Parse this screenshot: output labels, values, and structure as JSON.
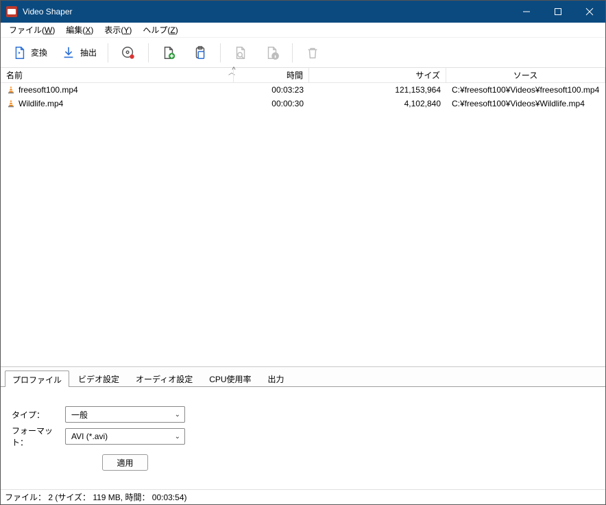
{
  "title": "Video Shaper",
  "menu": {
    "file": "ファイル(W)",
    "edit": "編集(X)",
    "view": "表示(Y)",
    "help": "ヘルプ(Z)"
  },
  "menu_ul": {
    "file": "W",
    "edit": "X",
    "view": "Y",
    "help": "Z"
  },
  "toolbar": {
    "convert": "変換",
    "extract": "抽出",
    "burn_icon": "burn-disc-icon",
    "add_icon": "add-file-icon",
    "paste_icon": "paste-icon",
    "preview_icon": "preview-icon",
    "info_icon": "file-info-icon",
    "delete_icon": "delete-icon"
  },
  "columns": {
    "name": "名前",
    "time": "時間",
    "size": "サイズ",
    "source": "ソース"
  },
  "rows": [
    {
      "name": "freesoft100.mp4",
      "time": "00:03:23",
      "size": "121,153,964",
      "source": "C:¥freesoft100¥Videos¥freesoft100.mp4"
    },
    {
      "name": "Wildlife.mp4",
      "time": "00:00:30",
      "size": "4,102,840",
      "source": "C:¥freesoft100¥Videos¥Wildlife.mp4"
    }
  ],
  "tabs": {
    "profile": "プロファイル",
    "video": "ビデオ設定",
    "audio": "オーディオ設定",
    "cpu": "CPU使用率",
    "output": "出力"
  },
  "profile_form": {
    "type_label": "タイプ：",
    "type_value": "一般",
    "format_label": "フォーマット：",
    "format_value": "AVI (*.avi)",
    "apply": "適用"
  },
  "status": "ファイル： 2 (サイズ： 119 MB, 時間： 00:03:54)"
}
